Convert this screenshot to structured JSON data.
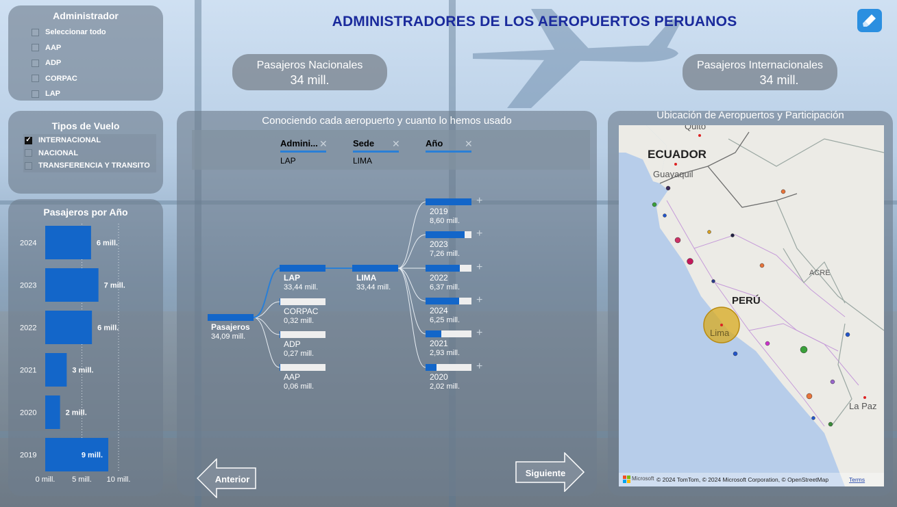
{
  "header": {
    "title": "ADMINISTRADORES DE LOS AEROPUERTOS PERUANOS"
  },
  "admin_slicer": {
    "title": "Administrador",
    "items": [
      {
        "label": "Seleccionar todo",
        "checked": false
      },
      {
        "label": "AAP",
        "checked": false
      },
      {
        "label": "ADP",
        "checked": false
      },
      {
        "label": "CORPAC",
        "checked": false
      },
      {
        "label": "LAP",
        "checked": false
      }
    ]
  },
  "tipo_slicer": {
    "title": "Tipos de Vuelo",
    "items": [
      {
        "label": "INTERNACIONAL",
        "checked": true
      },
      {
        "label": "NACIONAL",
        "checked": false
      },
      {
        "label": "TRANSFERENCIA Y TRANSITO",
        "checked": false
      }
    ]
  },
  "kpi_nacionales": {
    "label": "Pasajeros Nacionales",
    "value": "34 mill."
  },
  "kpi_internacionales": {
    "label": "Pasajeros Internacionales",
    "value": "34 mill."
  },
  "year_chart": {
    "title": "Pasajeros por Año",
    "xticks": [
      "0 mill.",
      "5 mill.",
      "10 mill."
    ]
  },
  "chart_data": {
    "type": "bar",
    "orientation": "horizontal",
    "title": "Pasajeros por Año",
    "categories": [
      "2024",
      "2023",
      "2022",
      "2021",
      "2020",
      "2019"
    ],
    "values": [
      6.25,
      7.26,
      6.37,
      2.93,
      2.02,
      8.6
    ],
    "data_labels": [
      "6 mill.",
      "7 mill.",
      "6 mill.",
      "3 mill.",
      "2 mill.",
      "9 mill."
    ],
    "xlim": [
      0,
      10
    ],
    "xtick_labels": [
      "0 mill.",
      "5 mill.",
      "10 mill."
    ],
    "color": "#1366c9",
    "grid": true
  },
  "tree": {
    "title": "Conociendo cada aeropuerto y cuanto lo hemos usado",
    "filters": [
      {
        "label": "Admini...",
        "value": "LAP"
      },
      {
        "label": "Sede",
        "value": "LIMA"
      },
      {
        "label": "Año",
        "value": ""
      }
    ],
    "root": {
      "name": "Pasajeros",
      "value": "34,09 mill.",
      "fill": 1.0
    },
    "admins": [
      {
        "name": "LAP",
        "value": "33,44 mill.",
        "fill": 1.0,
        "active": true
      },
      {
        "name": "CORPAC",
        "value": "0,32 mill.",
        "fill": 0.01,
        "active": false
      },
      {
        "name": "ADP",
        "value": "0,27 mill.",
        "fill": 0.008,
        "active": false
      },
      {
        "name": "AAP",
        "value": "0,06 mill.",
        "fill": 0.002,
        "active": false
      }
    ],
    "sede": {
      "name": "LIMA",
      "value": "33,44 mill.",
      "fill": 1.0
    },
    "years": [
      {
        "name": "2019",
        "value": "8,60 mill.",
        "fill": 1.0
      },
      {
        "name": "2023",
        "value": "7,26 mill.",
        "fill": 0.844
      },
      {
        "name": "2022",
        "value": "6,37 mill.",
        "fill": 0.741
      },
      {
        "name": "2024",
        "value": "6,25 mill.",
        "fill": 0.727
      },
      {
        "name": "2021",
        "value": "2,93 mill.",
        "fill": 0.341
      },
      {
        "name": "2020",
        "value": "2,02 mill.",
        "fill": 0.235
      }
    ],
    "plus": "+",
    "close": "✕"
  },
  "map": {
    "title": "Ubicación de Aeropuertos y Participación",
    "labels": {
      "ecuador": "ECUADOR",
      "quito": "Quito",
      "guayaquil": "Guayaquil",
      "peru": "PERÚ",
      "acre": "ACRE",
      "lima": "Lima",
      "lapaz": "La Paz"
    },
    "attribution": "© 2024 TomTom, © 2024 Microsoft Corporation, © OpenStreetMap",
    "terms": "Terms",
    "brand": "Microsoft"
  },
  "nav": {
    "prev": "Anterior",
    "next": "Siguiente"
  }
}
